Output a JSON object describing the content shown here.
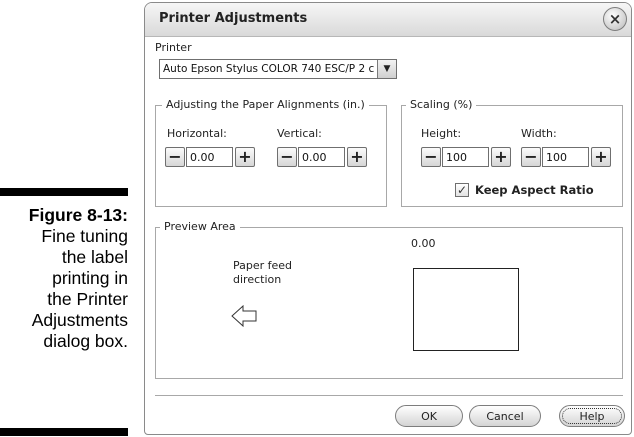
{
  "caption": {
    "figure": "Figure 8-13:",
    "lines": [
      "Fine tuning",
      "the label",
      "printing in",
      "the Printer",
      "Adjustments",
      "dialog box."
    ]
  },
  "dialog": {
    "title": "Printer Adjustments",
    "close_glyph": "×",
    "printer_label": "Printer",
    "printer_value": "Auto Epson Stylus COLOR 740 ESC/P 2 c",
    "alignment": {
      "legend": "Adjusting the Paper Alignments (in.)",
      "horizontal_label": "Horizontal:",
      "horizontal_value": "0.00",
      "vertical_label": "Vertical:",
      "vertical_value": "0.00"
    },
    "scaling": {
      "legend": "Scaling (%)",
      "height_label": "Height:",
      "height_value": "100",
      "width_label": "Width:",
      "width_value": "100",
      "keep_aspect_label": "Keep Aspect Ratio",
      "keep_aspect_checked": true
    },
    "preview": {
      "legend": "Preview Area",
      "readout": "0.00",
      "feed_line1": "Paper feed",
      "feed_line2": "direction"
    },
    "buttons": {
      "ok": "OK",
      "cancel": "Cancel",
      "help": "Help"
    },
    "minus": "−",
    "plus": "+"
  }
}
